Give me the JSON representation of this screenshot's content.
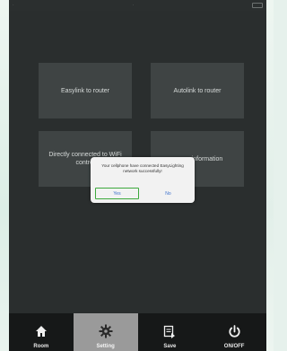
{
  "tiles": [
    {
      "label": "Easylink to router"
    },
    {
      "label": "Autolink to router"
    },
    {
      "label": "Directly connected to WiFi control"
    },
    {
      "label": "information"
    }
  ],
  "dialog": {
    "message": "Your cellphone have connected EasyLighting network successfully!",
    "yes_label": "Yes",
    "no_label": "No"
  },
  "tabbar": {
    "tabs": [
      {
        "label": "Room",
        "icon": "home-icon",
        "active": false
      },
      {
        "label": "Setting",
        "icon": "gear-icon",
        "active": true
      },
      {
        "label": "Save",
        "icon": "save-icon",
        "active": false
      },
      {
        "label": "ON/OFF",
        "icon": "power-icon",
        "active": false
      }
    ]
  },
  "colors": {
    "screen_bg": "#2a2e2e",
    "tile_bg": "#3f4444",
    "tabbar_bg": "#161818",
    "active_tab_bg": "#9a9a9a",
    "yes_outline": "#3da93d",
    "dialog_text_button": "#3a6fcc"
  }
}
